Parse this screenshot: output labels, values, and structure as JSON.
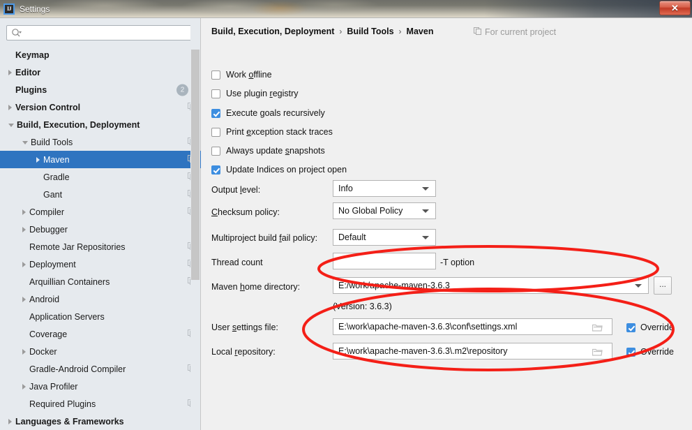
{
  "window": {
    "title": "Settings",
    "app_icon": "IJ",
    "close_label": "✕"
  },
  "sidebar": {
    "search": {
      "value": "",
      "placeholder": ""
    },
    "items": [
      {
        "label": "Keymap",
        "indent": 0,
        "arrow": "none",
        "bold": true,
        "copy": false,
        "badge": "",
        "selected": false
      },
      {
        "label": "Editor",
        "indent": 0,
        "arrow": "right",
        "bold": true,
        "copy": false,
        "badge": "",
        "selected": false
      },
      {
        "label": "Plugins",
        "indent": 0,
        "arrow": "none",
        "bold": true,
        "copy": false,
        "badge": "2",
        "selected": false
      },
      {
        "label": "Version Control",
        "indent": 0,
        "arrow": "right",
        "bold": true,
        "copy": true,
        "badge": "",
        "selected": false
      },
      {
        "label": "Build, Execution, Deployment",
        "indent": 0,
        "arrow": "down",
        "bold": true,
        "copy": false,
        "badge": "",
        "selected": false
      },
      {
        "label": "Build Tools",
        "indent": 1,
        "arrow": "down",
        "bold": false,
        "copy": true,
        "badge": "",
        "selected": false
      },
      {
        "label": "Maven",
        "indent": 2,
        "arrow": "right",
        "bold": false,
        "copy": true,
        "badge": "",
        "selected": true
      },
      {
        "label": "Gradle",
        "indent": 2,
        "arrow": "none",
        "bold": false,
        "copy": true,
        "badge": "",
        "selected": false
      },
      {
        "label": "Gant",
        "indent": 2,
        "arrow": "none",
        "bold": false,
        "copy": true,
        "badge": "",
        "selected": false
      },
      {
        "label": "Compiler",
        "indent": 1,
        "arrow": "right",
        "bold": false,
        "copy": true,
        "badge": "",
        "selected": false
      },
      {
        "label": "Debugger",
        "indent": 1,
        "arrow": "right",
        "bold": false,
        "copy": false,
        "badge": "",
        "selected": false
      },
      {
        "label": "Remote Jar Repositories",
        "indent": 1,
        "arrow": "none",
        "bold": false,
        "copy": true,
        "badge": "",
        "selected": false
      },
      {
        "label": "Deployment",
        "indent": 1,
        "arrow": "right",
        "bold": false,
        "copy": true,
        "badge": "",
        "selected": false
      },
      {
        "label": "Arquillian Containers",
        "indent": 1,
        "arrow": "none",
        "bold": false,
        "copy": true,
        "badge": "",
        "selected": false
      },
      {
        "label": "Android",
        "indent": 1,
        "arrow": "right",
        "bold": false,
        "copy": false,
        "badge": "",
        "selected": false
      },
      {
        "label": "Application Servers",
        "indent": 1,
        "arrow": "none",
        "bold": false,
        "copy": false,
        "badge": "",
        "selected": false
      },
      {
        "label": "Coverage",
        "indent": 1,
        "arrow": "none",
        "bold": false,
        "copy": true,
        "badge": "",
        "selected": false
      },
      {
        "label": "Docker",
        "indent": 1,
        "arrow": "right",
        "bold": false,
        "copy": false,
        "badge": "",
        "selected": false
      },
      {
        "label": "Gradle-Android Compiler",
        "indent": 1,
        "arrow": "none",
        "bold": false,
        "copy": true,
        "badge": "",
        "selected": false
      },
      {
        "label": "Java Profiler",
        "indent": 1,
        "arrow": "right",
        "bold": false,
        "copy": false,
        "badge": "",
        "selected": false
      },
      {
        "label": "Required Plugins",
        "indent": 1,
        "arrow": "none",
        "bold": false,
        "copy": true,
        "badge": "",
        "selected": false
      },
      {
        "label": "Languages & Frameworks",
        "indent": 0,
        "arrow": "right",
        "bold": true,
        "copy": false,
        "badge": "",
        "selected": false
      }
    ]
  },
  "content": {
    "breadcrumb": {
      "part1": "Build, Execution, Deployment",
      "sep1": "›",
      "part2": "Build Tools",
      "sep2": "›",
      "part3": "Maven"
    },
    "for_current_project": "For current project",
    "checkboxes": [
      {
        "label": "Work offline",
        "checked": false
      },
      {
        "label": "Use plugin registry",
        "checked": false
      },
      {
        "label": "Execute goals recursively",
        "checked": true
      },
      {
        "label": "Print exception stack traces",
        "checked": false
      },
      {
        "label": "Always update snapshots",
        "checked": false
      },
      {
        "label": "Update Indices on project open",
        "checked": true
      }
    ],
    "fields": {
      "output_level": {
        "label": "Output level:",
        "value": "Info"
      },
      "checksum_policy": {
        "label": "Checksum policy:",
        "value": "No Global Policy"
      },
      "multiproject_fail_policy": {
        "label": "Multiproject build fail policy:",
        "value": "Default"
      },
      "thread_count": {
        "label": "Thread count",
        "value": "",
        "hint": "-T option"
      },
      "maven_home": {
        "label": "Maven home directory:",
        "value": "E:/work/apache-maven-3.6.3",
        "version_note": "(Version: 3.6.3)",
        "browse_label": "..."
      },
      "user_settings": {
        "label": "User settings file:",
        "value": "E:\\work\\apache-maven-3.6.3\\conf\\settings.xml",
        "override_label": "Override",
        "override_checked": true
      },
      "local_repository": {
        "label": "Local repository:",
        "value": "E:\\work\\apache-maven-3.6.3\\.m2\\repository",
        "override_label": "Override",
        "override_checked": true
      }
    }
  },
  "colors": {
    "accent": "#2f74c0",
    "checkbox_checked": "#3d8ee0",
    "annotation": "#f41f17",
    "sidebar_bg": "#e6eaee",
    "content_bg": "#f0f0f0",
    "close_button": "#c23b26"
  }
}
